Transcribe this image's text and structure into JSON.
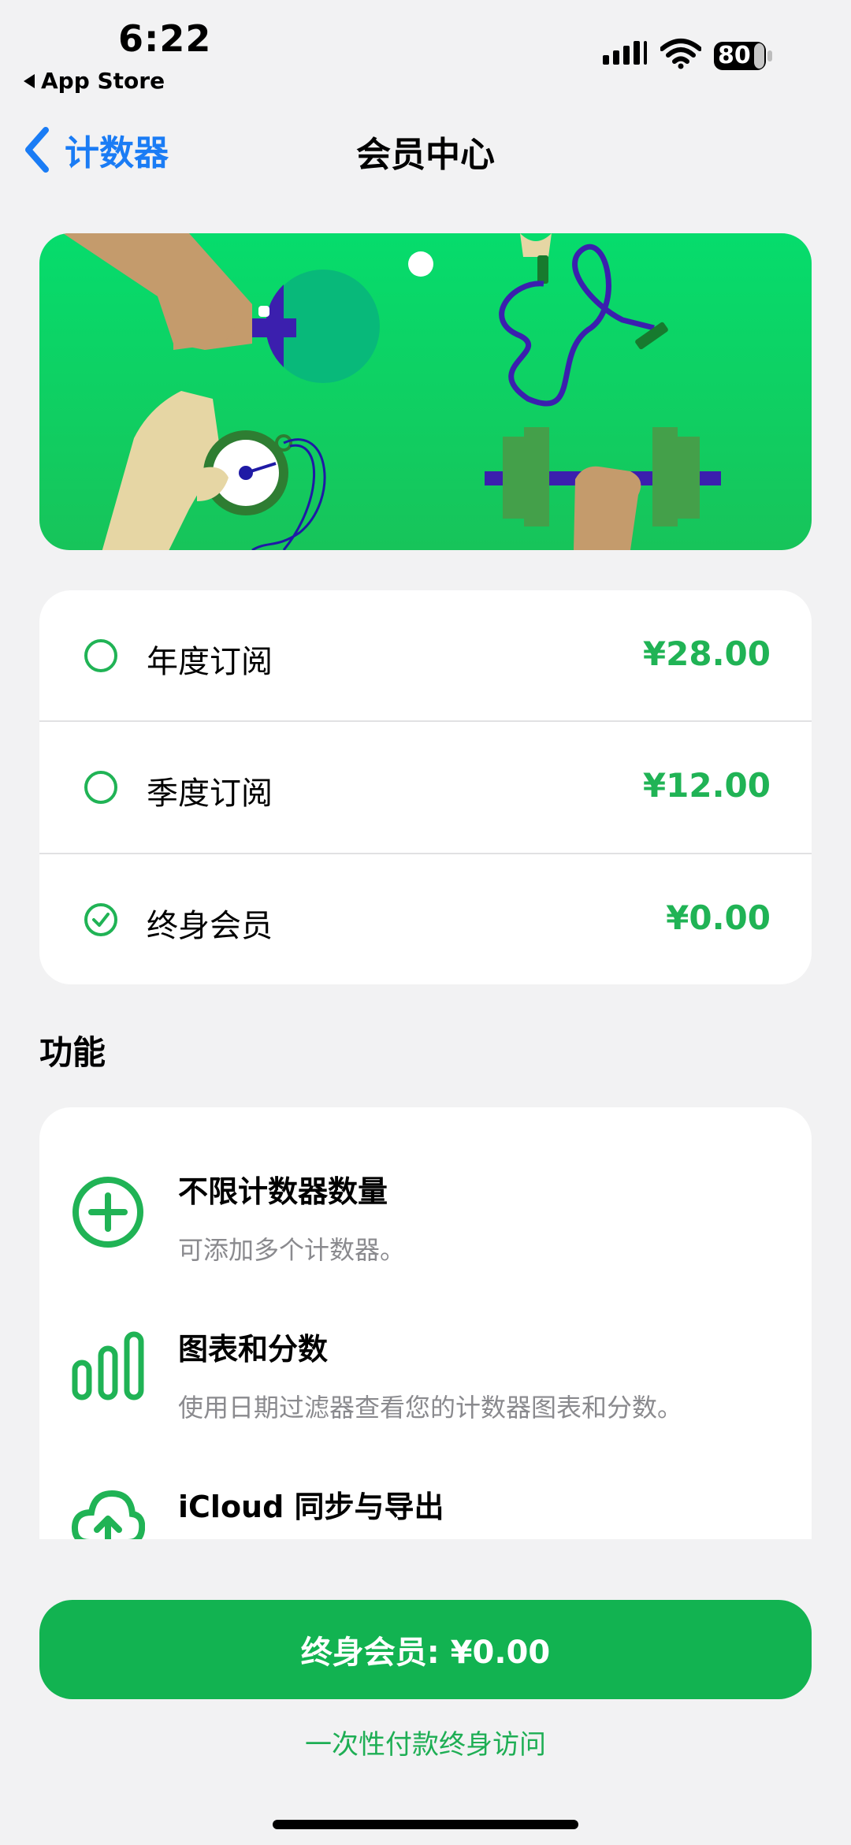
{
  "status_bar": {
    "time": "6:22",
    "back_app": "App Store",
    "battery": "80"
  },
  "nav": {
    "back_label": "计数器",
    "title": "会员中心"
  },
  "plans": [
    {
      "name": "年度订阅",
      "price": "¥28.00",
      "selected": false
    },
    {
      "name": "季度订阅",
      "price": "¥12.00",
      "selected": false
    },
    {
      "name": "终身会员",
      "price": "¥0.00",
      "selected": true
    }
  ],
  "features_section": {
    "title": "功能",
    "items": [
      {
        "icon": "plus-circle-icon",
        "title": "不限计数器数量",
        "desc": "可添加多个计数器。"
      },
      {
        "icon": "bar-chart-icon",
        "title": "图表和分数",
        "desc": "使用日期过滤器查看您的计数器图表和分数。"
      },
      {
        "icon": "cloud-upload-icon",
        "title": "iCloud 同步与导出",
        "desc": ""
      }
    ]
  },
  "cta": {
    "label": "终身会员: ¥0.00",
    "sub": "一次性付款终身访问"
  },
  "colors": {
    "accent_green": "#20b355",
    "cta_green": "#12b351",
    "link_blue": "#1a7cf5",
    "banner_green": "#0fd164"
  }
}
